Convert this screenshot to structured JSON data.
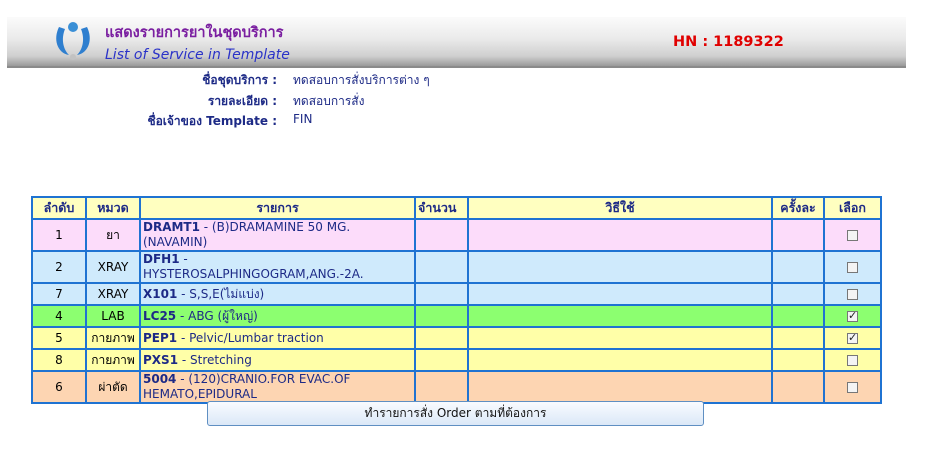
{
  "header": {
    "title_th": "แสดงรายการยาในชุดบริการ",
    "title_en": "List of Service in Template",
    "hn": "HN : 1189322",
    "logo_icon": "medical-logo-icon"
  },
  "info": [
    {
      "label": "ชื่อชุดบริการ :",
      "value": "ทดสอบการสั่งบริการต่าง ๆ"
    },
    {
      "label": "รายละเอียด :",
      "value": "ทดสอบการสั่ง"
    },
    {
      "label": "ชื่อเจ้าของ Template :",
      "value": "FIN"
    }
  ],
  "table": {
    "headers": [
      "ลำดับ",
      "หมวด",
      "รายการ",
      "จำนวน",
      "วิธีใช้",
      "ครั้งละ",
      "เลือก"
    ],
    "rows": [
      {
        "no": "1",
        "category": "ยา",
        "code": "DRAMT1",
        "desc": " - (B)DRAMAMINE 50 MG.(NAVAMIN)",
        "checked": false
      },
      {
        "no": "2",
        "category": "XRAY",
        "code": "DFH1",
        "desc": " - HYSTEROSALPHINGOGRAM,ANG.-2A.",
        "checked": false
      },
      {
        "no": "7",
        "category": "XRAY",
        "code": "X101",
        "desc": " - S,S,E(ไม่แบ่ง)",
        "checked": false
      },
      {
        "no": "4",
        "category": "LAB",
        "code": "LC25",
        "desc": " - ABG (ผู้ใหญ่)",
        "checked": true
      },
      {
        "no": "5",
        "category": "กายภาพ",
        "code": "PEP1",
        "desc": " - Pelvic/Lumbar traction",
        "checked": true
      },
      {
        "no": "8",
        "category": "กายภาพ",
        "code": "PXS1",
        "desc": " - Stretching",
        "checked": false
      },
      {
        "no": "6",
        "category": "ผ่าตัด",
        "code": "5004",
        "desc": " - (120)CRANIO.FOR EVAC.OF HEMATO,EPIDURAL",
        "checked": false
      }
    ]
  },
  "button": {
    "label": "ทำรายการสั่ง Order ตามที่ต้องการ"
  }
}
